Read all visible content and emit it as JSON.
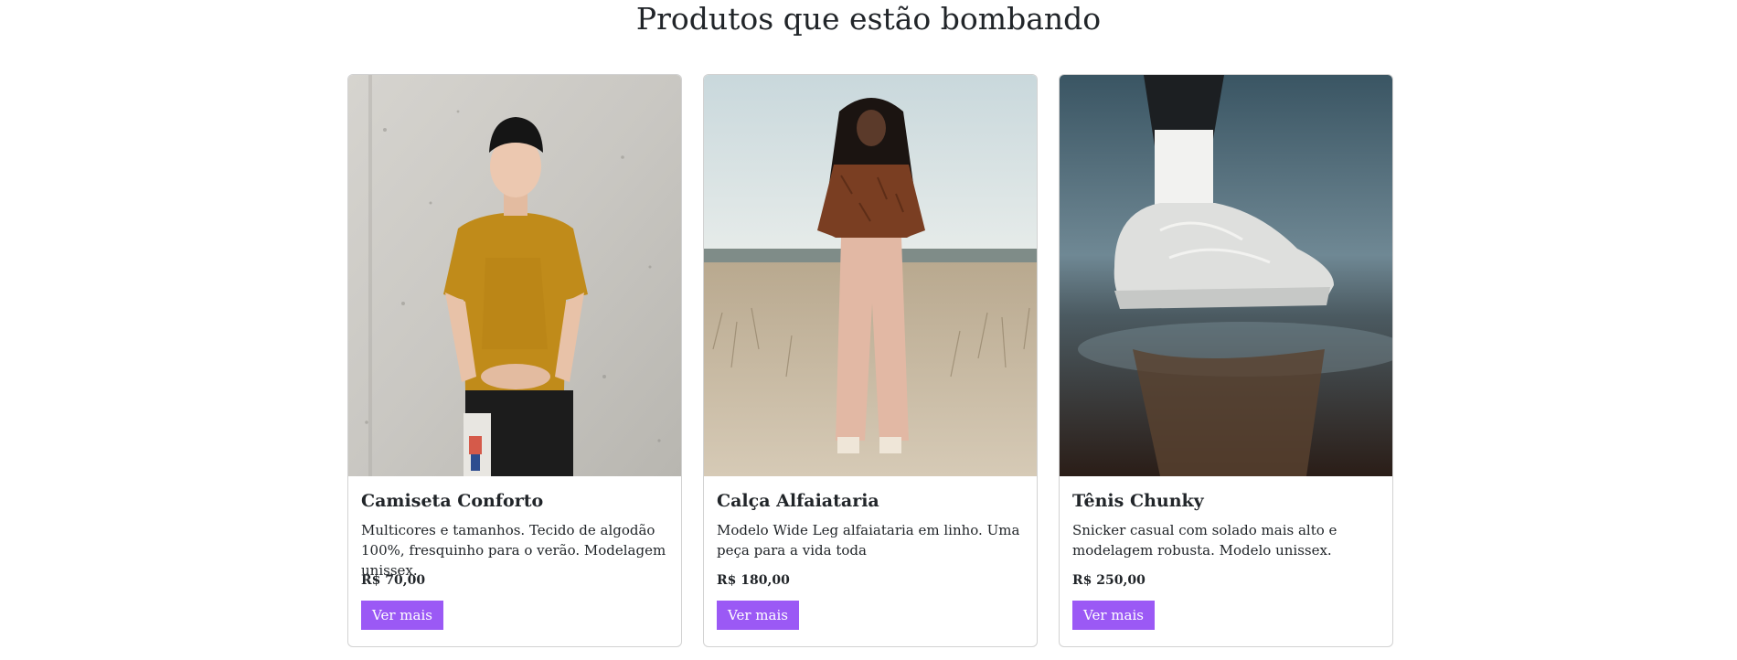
{
  "section": {
    "title": "Produtos que estão bombando"
  },
  "products": [
    {
      "image_subject": "young man in mustard t-shirt and black beanie against concrete wall",
      "title": "Camiseta Conforto",
      "description": "Multicores e tamanhos. Tecido de algodão 100%, fresquinho para o verão. Modelagem unissex.",
      "price": "R$ 70,00",
      "button_label": "Ver mais"
    },
    {
      "image_subject": "woman in brown patterned shirt and light pink wide-leg trousers in a field",
      "title": "Calça Alfaiataria",
      "description": "Modelo Wide Leg alfaiataria em linho. Uma peça para a vida toda",
      "price": "R$ 180,00",
      "button_label": "Ver mais"
    },
    {
      "image_subject": "white chunky sneaker stepping into a water puddle",
      "title": "Tênis Chunky",
      "description": "Snicker casual com solado mais alto e modelagem robusta. Modelo unissex.",
      "price": "R$ 250,00",
      "button_label": "Ver mais"
    }
  ],
  "colors": {
    "button": "#9b59f5",
    "text": "#212529"
  }
}
